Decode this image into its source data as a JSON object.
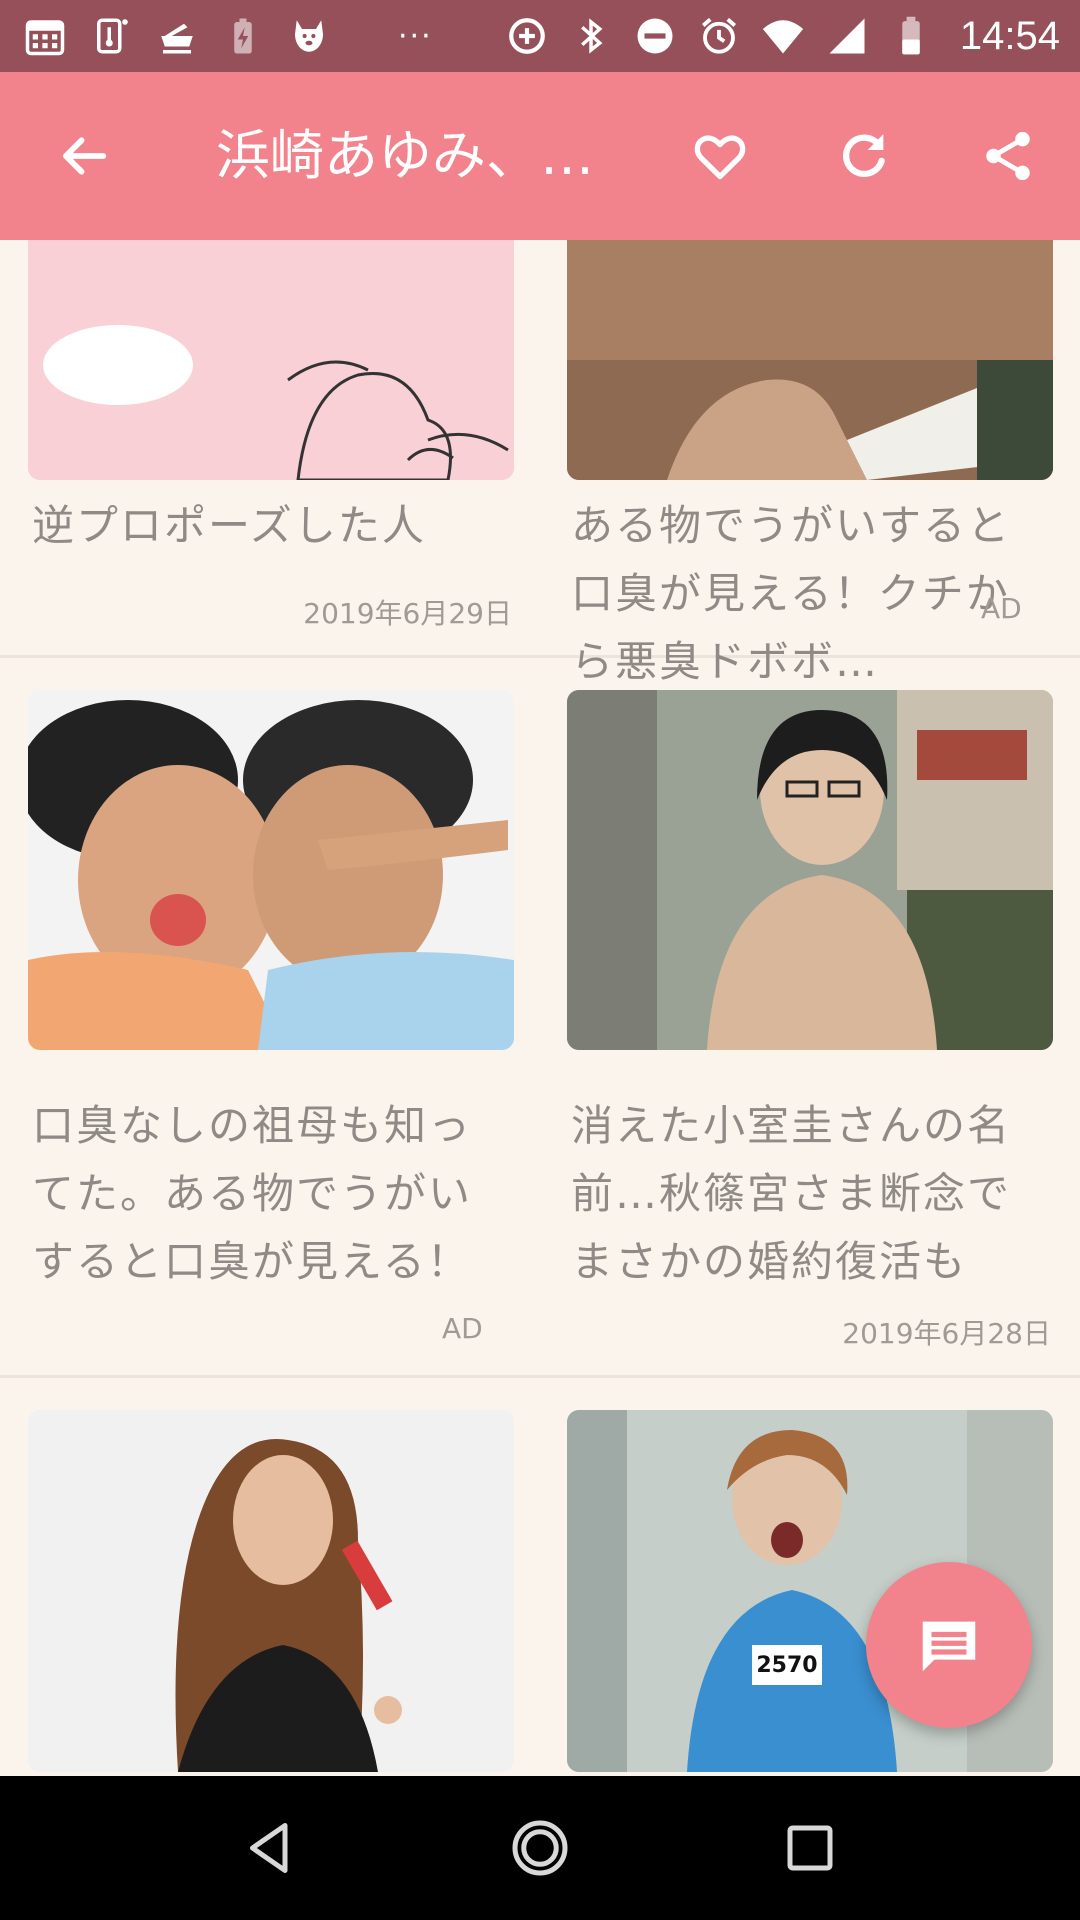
{
  "status_bar": {
    "time": "14:54",
    "overflow": "···",
    "icons_left": [
      "calendar-icon",
      "thermometer-icon",
      "bowl-icon",
      "battery-charging-icon",
      "dog-icon"
    ],
    "icons_right": [
      "add-circle-icon",
      "bluetooth-icon",
      "do-not-disturb-icon",
      "alarm-icon",
      "wifi-icon",
      "signal-icon",
      "battery-icon"
    ]
  },
  "app_bar": {
    "title": "浜崎あゆみ、…",
    "back_icon": "arrow-left-icon",
    "favorite_icon": "heart-icon",
    "refresh_icon": "refresh-icon",
    "share_icon": "share-icon"
  },
  "articles": [
    {
      "title": "逆プロポーズした人",
      "meta": "2019年6月29日"
    },
    {
      "title": "ある物でうがいすると口臭が見える！クチから悪臭ドボボ…",
      "meta": "AD"
    },
    {
      "title": "口臭なしの祖母も知ってた。ある物でうがいすると口臭が見える！",
      "meta": "AD"
    },
    {
      "title": "消えた小室圭さんの名前…秋篠宮さま断念でまさかの婚約復活も",
      "meta": "2019年6月28日"
    }
  ],
  "photo_badge": "2570",
  "fab": {
    "icon": "message-icon"
  },
  "nav_bar": {
    "icons": [
      "back-triangle-icon",
      "home-circle-icon",
      "recents-square-icon"
    ]
  },
  "colors": {
    "status_bar": "#96505a",
    "app_bar": "#f2838c",
    "background": "#faf4ec",
    "text_muted": "#8f8a86",
    "fab": "#f2838c"
  }
}
